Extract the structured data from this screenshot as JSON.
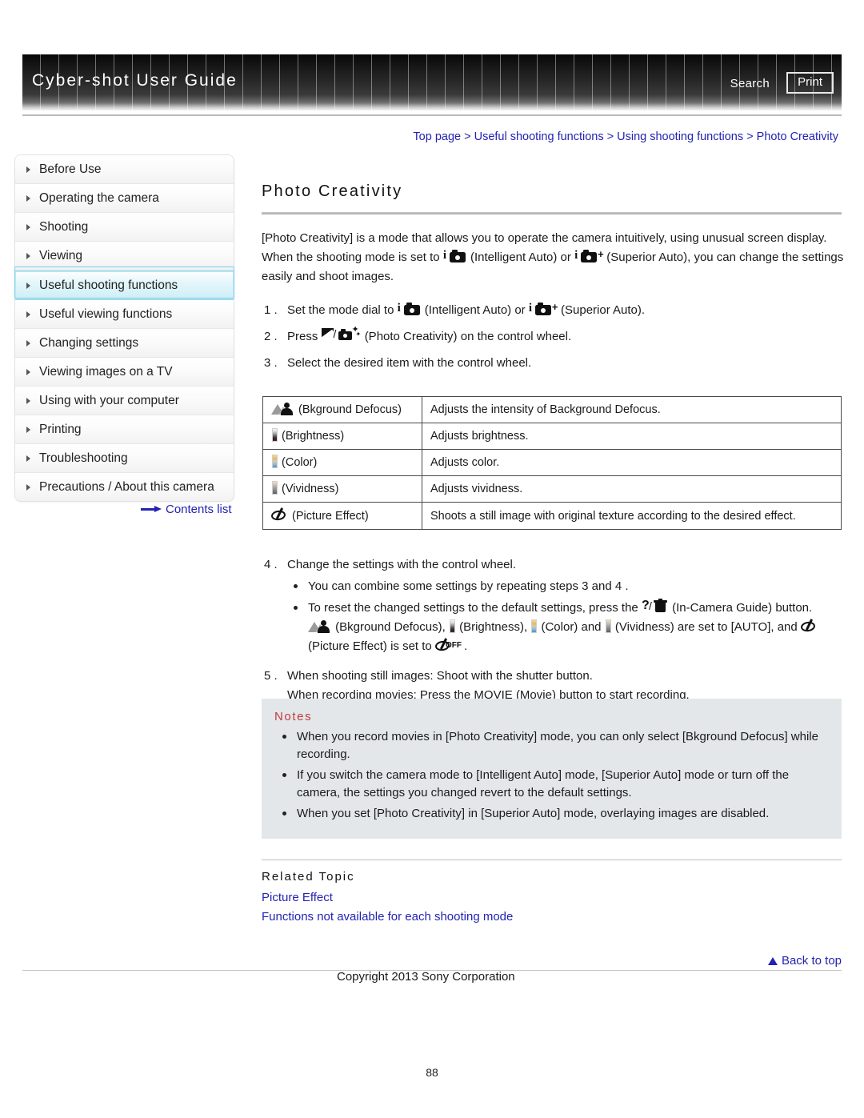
{
  "header": {
    "title": "Cyber-shot User Guide",
    "search_label": "Search",
    "print_label": "Print"
  },
  "sidebar": {
    "items": [
      {
        "label": "Before Use",
        "active": false
      },
      {
        "label": "Operating the camera",
        "active": false
      },
      {
        "label": "Shooting",
        "active": false
      },
      {
        "label": "Viewing",
        "active": false
      },
      {
        "label": "Useful shooting functions",
        "active": true
      },
      {
        "label": "Useful viewing functions",
        "active": false
      },
      {
        "label": "Changing settings",
        "active": false
      },
      {
        "label": "Viewing images on a TV",
        "active": false
      },
      {
        "label": "Using with your computer",
        "active": false
      },
      {
        "label": "Printing",
        "active": false
      },
      {
        "label": "Troubleshooting",
        "active": false
      },
      {
        "label": "Precautions / About this camera",
        "active": false
      }
    ],
    "contents_list_label": "Contents list"
  },
  "main": {
    "breadcrumb": "Top page > Useful shooting functions > Using shooting functions > Photo Creativity",
    "page_title": "Photo Creativity",
    "intro_1": "[Photo Creativity] is a mode that allows you to operate the camera intuitively, using unusual screen display.",
    "intro_2a": "When the shooting mode is set to",
    "intro_2b": "(Intelligent Auto) or",
    "intro_2c": "(Superior Auto), you can change the settings easily and shoot images.",
    "steps": [
      {
        "num": "1 .",
        "a": "Set the mode dial to",
        "b": "(Intelligent Auto) or",
        "c": "(Superior Auto)."
      },
      {
        "num": "2 .",
        "a": "Press",
        "b": "(Photo Creativity) on the control wheel."
      },
      {
        "num": "3 .",
        "a": "Select the desired item with the control wheel."
      }
    ],
    "table": {
      "rows": [
        {
          "icon": "bkground-defocus-icon",
          "name": "(Bkground Defocus)",
          "desc": "Adjusts the intensity of Background Defocus."
        },
        {
          "icon": "brightness-icon",
          "name": "(Brightness)",
          "desc": "Adjusts brightness."
        },
        {
          "icon": "color-icon",
          "name": "(Color)",
          "desc": "Adjusts color."
        },
        {
          "icon": "vividness-icon",
          "name": "(Vividness)",
          "desc": "Adjusts vividness."
        },
        {
          "icon": "picture-effect-icon",
          "name": "(Picture Effect)",
          "desc": "Shoots a still image with original texture according to the desired effect."
        }
      ]
    },
    "step4": {
      "num": "4 .",
      "title": "Change the settings with the control wheel.",
      "bullet1": "You can combine some settings by repeating steps 3 and 4 .",
      "bullet2a": "To reset the changed settings to the default settings, press the",
      "bullet2b": "(In-Camera Guide) button.",
      "bullet2c": "(Bkground Defocus),",
      "bullet2d": "(Brightness),",
      "bullet2e": "(Color) and",
      "bullet2f": "(Vividness) are set to [AUTO], and",
      "bullet2g": "(Picture Effect) is set to",
      "bullet2h": "."
    },
    "step5": {
      "num": "5 .",
      "line1": "When shooting still images: Shoot with the shutter button.",
      "line2": "When recording movies: Press the MOVIE (Movie) button to start recording."
    },
    "notes": {
      "title": "Notes",
      "items": [
        "When you record movies in [Photo Creativity] mode, you can only select [Bkground Defocus] while recording.",
        "If you switch the camera mode to [Intelligent Auto] mode, [Superior Auto] mode or turn off the camera, the settings you changed revert to the default settings.",
        "When you set [Photo Creativity] in [Superior Auto] mode, overlaying images are disabled."
      ]
    },
    "related": {
      "title": "Related Topic",
      "links": [
        "Picture Effect",
        "Functions not available for each shooting mode"
      ]
    },
    "back_to_top": "Back to top",
    "copyright": "Copyright 2013 Sony Corporation",
    "page_number": "88"
  },
  "colors": {
    "link": "#2323B4",
    "notes_title": "#C33A3A",
    "notes_bg": "#E4E7EA",
    "sidebar_active": "#CFEEF7",
    "header_dark": "#1A1A1A"
  }
}
